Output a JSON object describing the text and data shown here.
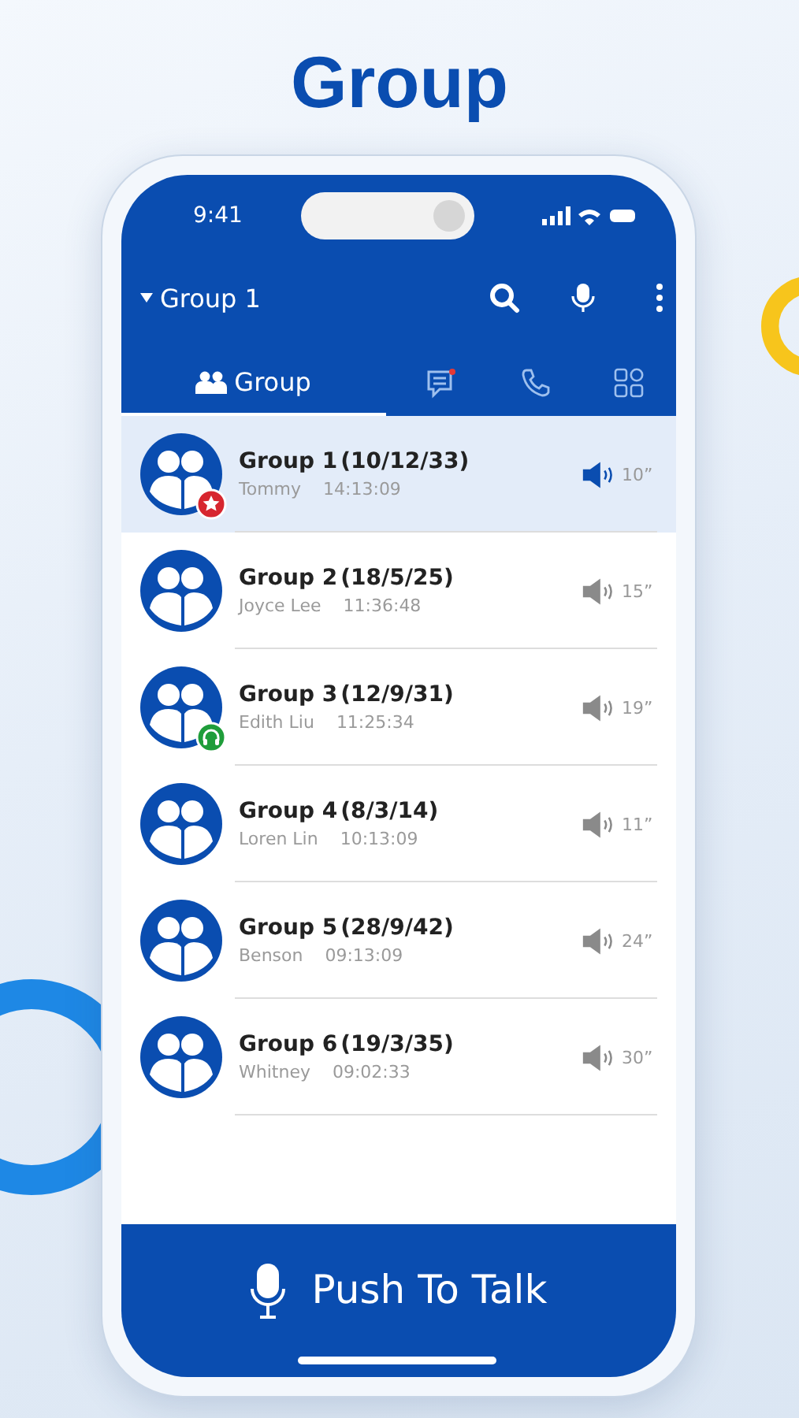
{
  "headline": "Group",
  "status_bar": {
    "time": "9:41"
  },
  "header": {
    "title": "Group 1"
  },
  "tabs": [
    {
      "kind": "group",
      "label": "Group",
      "selected": true
    },
    {
      "kind": "messages",
      "unread": true,
      "selected": false
    },
    {
      "kind": "calls",
      "selected": false
    },
    {
      "kind": "apps",
      "selected": false
    }
  ],
  "groups": [
    {
      "name": "Group 1",
      "counts": "(10/12/33)",
      "speaker": "Tommy",
      "time": "14:13:09",
      "duration": "10”",
      "selected": true,
      "favorite": true,
      "monitoring": false
    },
    {
      "name": "Group 2",
      "counts": "(18/5/25)",
      "speaker": "Joyce Lee",
      "time": "11:36:48",
      "duration": "15”",
      "selected": false,
      "favorite": false,
      "monitoring": false
    },
    {
      "name": "Group 3",
      "counts": "(12/9/31)",
      "speaker": "Edith Liu",
      "time": "11:25:34",
      "duration": "19”",
      "selected": false,
      "favorite": false,
      "monitoring": true
    },
    {
      "name": "Group 4",
      "counts": "(8/3/14)",
      "speaker": "Loren Lin",
      "time": "10:13:09",
      "duration": "11”",
      "selected": false,
      "favorite": false,
      "monitoring": false
    },
    {
      "name": "Group 5",
      "counts": "(28/9/42)",
      "speaker": "Benson",
      "time": "09:13:09",
      "duration": "24”",
      "selected": false,
      "favorite": false,
      "monitoring": false
    },
    {
      "name": "Group 6",
      "counts": "(19/3/35)",
      "speaker": "Whitney",
      "time": "09:02:33",
      "duration": "30”",
      "selected": false,
      "favorite": false,
      "monitoring": false
    }
  ],
  "push_to_talk": {
    "label": "Push To Talk"
  }
}
